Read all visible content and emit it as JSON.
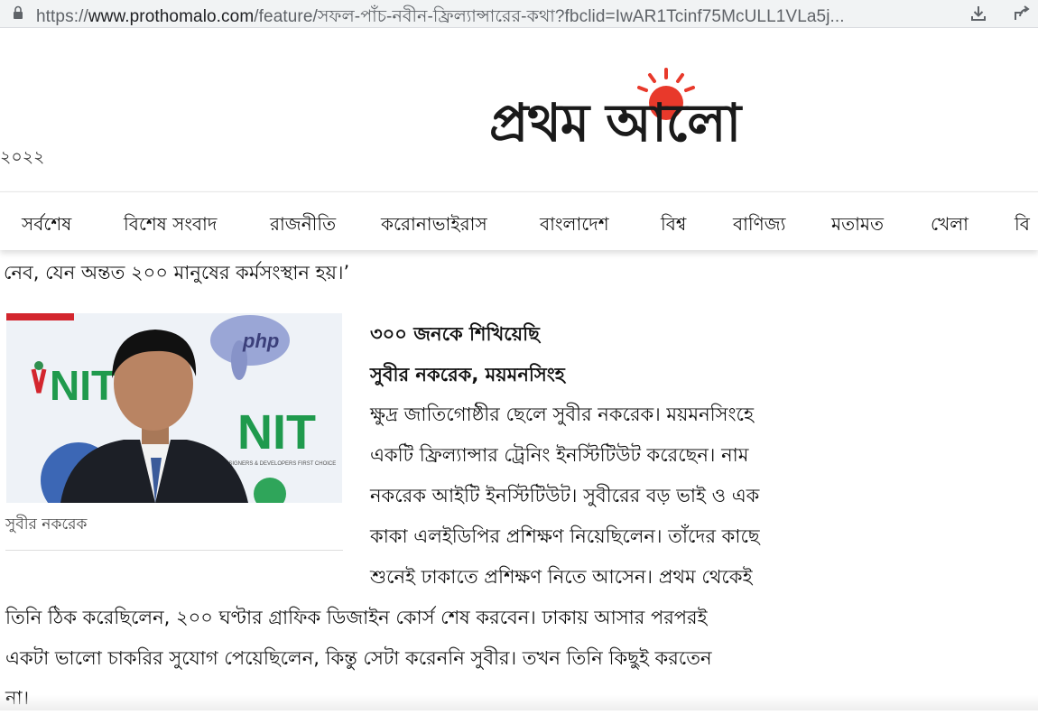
{
  "browser": {
    "url_prefix": "https://",
    "url_host": "www.prothomalo.com",
    "url_path": "/feature/সফল-পাঁচ-নবীন-ফ্রিল্যান্সারের-কথা?fbclid=IwAR1Tcinf75McULL1VLa5j...",
    "icons": [
      "lock-icon",
      "download-icon",
      "share-icon"
    ]
  },
  "masthead": {
    "date_fragment": "২০২২",
    "logo_text": "প্রথম আলো",
    "sun_color": "#e8392b"
  },
  "nav": {
    "items": [
      "সর্বশেষ",
      "বিশেষ সংবাদ",
      "রাজনীতি",
      "করোনাভাইরাস",
      "বাংলাদেশ",
      "বিশ্ব",
      "বাণিজ্য",
      "মতামত",
      "খেলা",
      "বি"
    ]
  },
  "article": {
    "lead_line": "নেব, যেন অন্তত ২০০ মানুষের কর্মসংস্থান হয়।’",
    "photo": {
      "banner_text": "NIT",
      "tagline": "DESIGNERS & DEVELOPERS FIRST CHOICE",
      "badge_text": "php",
      "caption": "সুবীর নকরেক"
    },
    "subheading": "৩০০ জনকে শিখিয়েছি",
    "byline": "সুবীর নকরেক, ময়মনসিংহ",
    "body_lines": [
      "ক্ষুদ্র জাতিগোষ্ঠীর ছেলে সুবীর নকরেক। ময়মনসিংহে",
      "একটি ফ্রিল্যান্সার ট্রেনিং ইনস্টিটিউট করেছেন। নাম",
      "নকরেক আইটি ইনস্টিটিউট। সুবীরের বড় ভাই ও এক",
      "কাকা এলইডিপির প্রশিক্ষণ নিয়েছিলেন। তাঁদের কাছে",
      "শুনেই ঢাকাতে প্রশিক্ষণ নিতে আসেন। প্রথম থেকেই",
      "তিনি ঠিক করেছিলেন, ২০০ ঘণ্টার গ্রাফিক ডিজাইন কোর্স শেষ করবেন। ঢাকায় আসার পরপরই",
      "একটা ভালো চাকরির সুযোগ পেয়েছিলেন, কিন্তু সেটা করেননি সুবীর। তখন তিনি কিছুই করতেন",
      "না।"
    ]
  }
}
